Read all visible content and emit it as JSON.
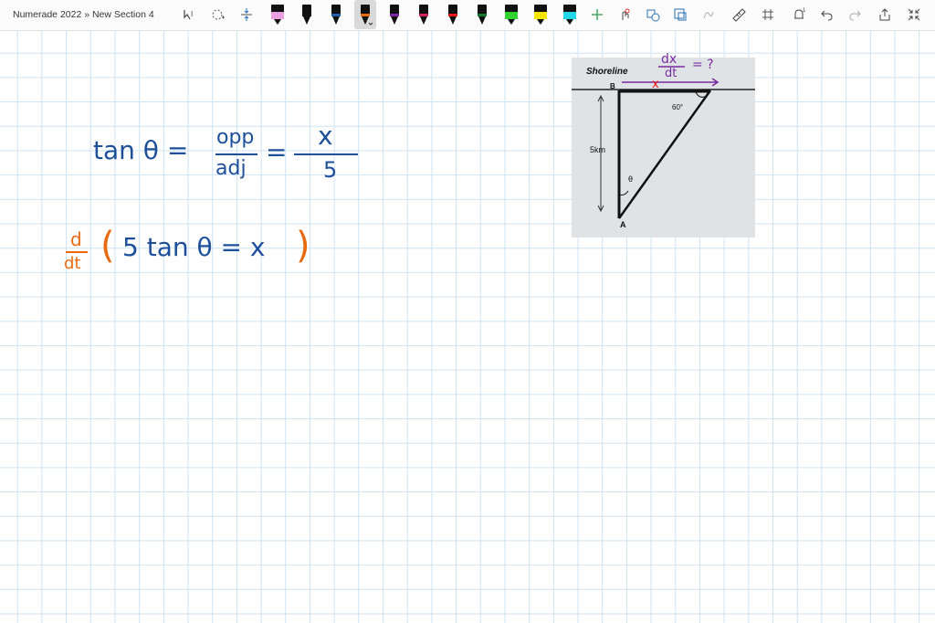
{
  "app": {
    "title": "Numerade 2022 » New Section 4"
  },
  "toolbar": {
    "tools": [
      "lasso-select-text-icon",
      "lasso-select-icon",
      "add-space-icon"
    ],
    "pens": [
      {
        "color": "#e8a0e0",
        "name": "pink-highlighter"
      },
      {
        "color": "#111111",
        "name": "black-pen"
      },
      {
        "color": "#1f5fa8",
        "name": "blue-pen"
      },
      {
        "color": "#e86a10",
        "name": "orange-pen",
        "selected": true
      },
      {
        "color": "#7a2aa0",
        "name": "purple-pen"
      },
      {
        "color": "#d4245a",
        "name": "magenta-pen"
      },
      {
        "color": "#e81818",
        "name": "red-pen"
      },
      {
        "color": "#137a2a",
        "name": "green-pen"
      },
      {
        "color": "#30d230",
        "name": "lime-highlighter"
      },
      {
        "color": "#f2e600",
        "name": "yellow-highlighter"
      },
      {
        "color": "#20d8e8",
        "name": "cyan-highlighter"
      }
    ]
  },
  "handwriting": {
    "line1": {
      "lhs": "tan θ =",
      "num1": "opp",
      "den1": "adj",
      "eq": "=",
      "num2": "x",
      "den2": "5"
    },
    "line2": {
      "num": "d",
      "den": "dt",
      "open": "(",
      "expr": "5 tan θ = x",
      "close": ")"
    }
  },
  "figure": {
    "shoreline": "Shoreline",
    "b": "B",
    "a": "A",
    "angle60": "60°",
    "distance": "5km",
    "theta": "θ",
    "annot_num": "dx",
    "annot_den": "dt",
    "annot_eq": "= ?",
    "annot_x": "x"
  }
}
